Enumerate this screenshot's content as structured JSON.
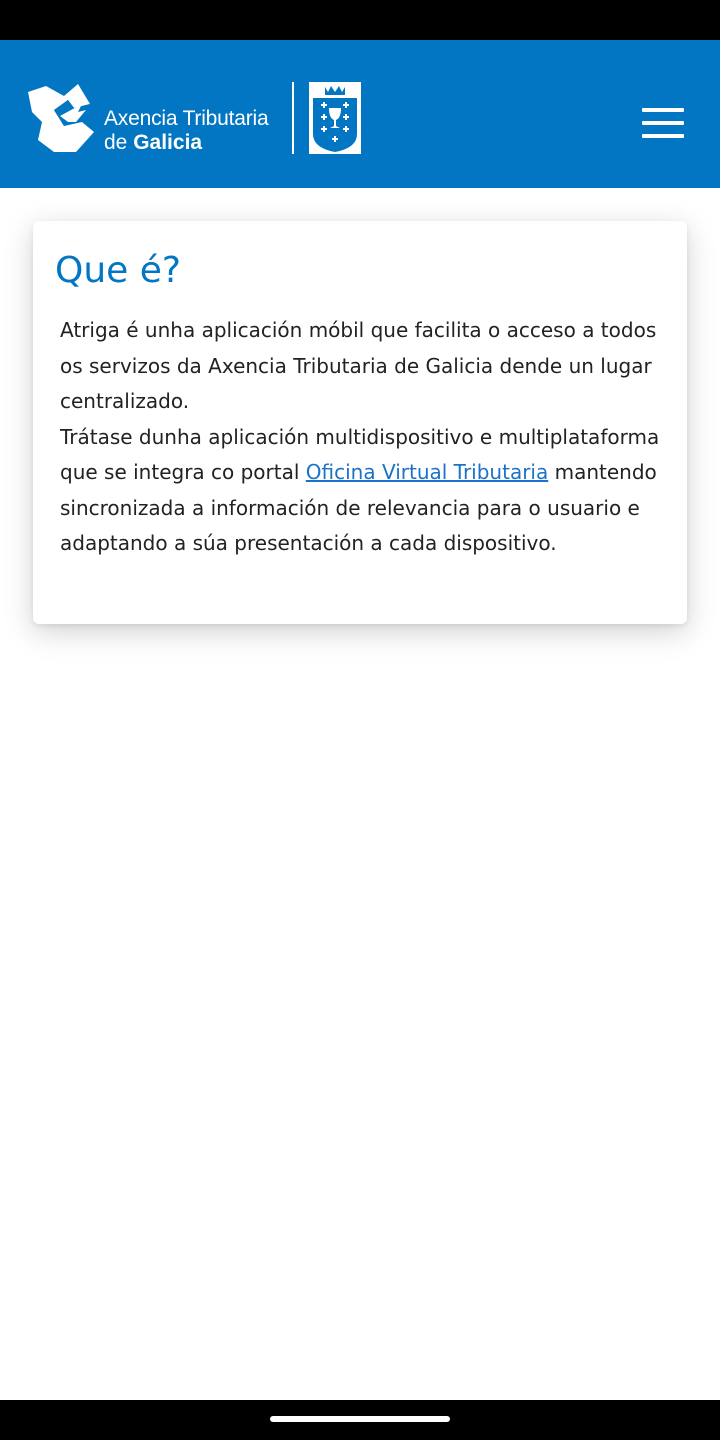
{
  "header": {
    "logo_line1": "Axencia Tributaria",
    "logo_line2_prefix": "de ",
    "logo_line2_bold": "Galicia",
    "logo_icon": "atriga-arrow-logo",
    "emblem_icon": "galicia-coat-of-arms",
    "menu_icon": "hamburger-menu-icon",
    "background_color": "#0276c3"
  },
  "card": {
    "title": "Que é?",
    "paragraph1": "Atriga é unha aplicación móbil que facilita o acceso a todos os servizos da Axencia Tributaria de Galicia dende un lugar centralizado.",
    "paragraph2_before": "Trátase dunha aplicación multidispositivo e multiplataforma que se integra co portal ",
    "paragraph2_link": "Oficina Virtual Tributaria",
    "paragraph2_after": " mantendo sincronizada a información de relevancia para o usuario e adaptando a súa presentación a cada dispositivo.",
    "title_color": "#0276c3",
    "link_color": "#1a73c8"
  }
}
